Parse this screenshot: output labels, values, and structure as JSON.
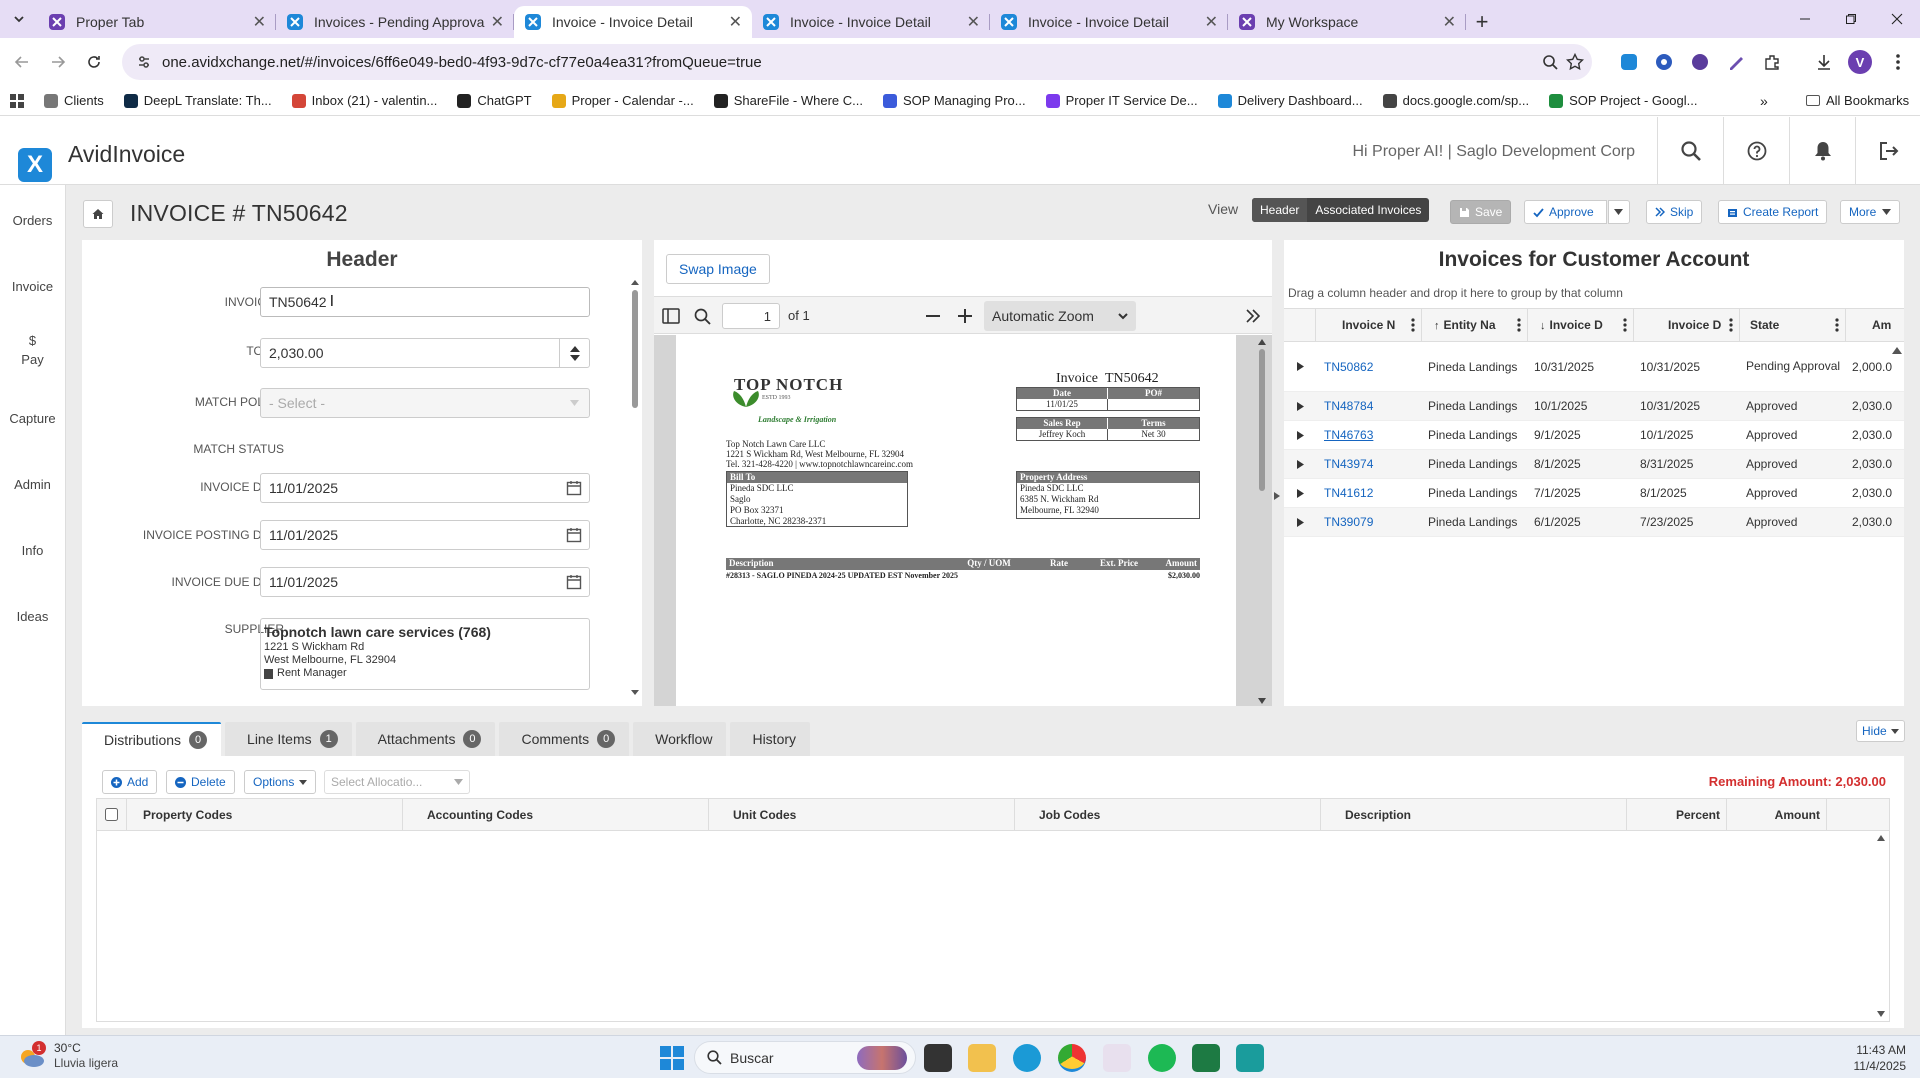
{
  "browser": {
    "tabs": [
      {
        "title": "Proper Tab",
        "active": false
      },
      {
        "title": "Invoices - Pending Approval",
        "active": false
      },
      {
        "title": "Invoice - Invoice Detail",
        "active": true
      },
      {
        "title": "Invoice - Invoice Detail",
        "active": false
      },
      {
        "title": "Invoice - Invoice Detail",
        "active": false
      },
      {
        "title": "My Workspace",
        "active": false
      }
    ],
    "url": "one.avidxchange.net/#/invoices/6ff6e049-bed0-4f93-9d7c-cf77e0a4ea31?fromQueue=true",
    "profile_initial": "V",
    "bookmarks": [
      "Clients",
      "DeepL Translate: Th...",
      "Inbox (21) - valentin...",
      "ChatGPT",
      "Proper - Calendar -...",
      "ShareFile - Where C...",
      "SOP Managing Pro...",
      "Proper IT Service De...",
      "Delivery Dashboard...",
      "docs.google.com/sp...",
      "SOP Project - Googl..."
    ],
    "all_bookmarks": "All Bookmarks"
  },
  "app": {
    "name": "AvidInvoice",
    "greeting": "Hi Proper AI! | Saglo Development Corp",
    "nav": [
      {
        "label": "Orders",
        "icon": "cart-icon"
      },
      {
        "label": "Invoice",
        "icon": "invoice-icon"
      },
      {
        "label": "Pay",
        "icon": "dollar-icon"
      },
      {
        "label": "Capture",
        "icon": "camera-icon"
      },
      {
        "label": "Admin",
        "icon": "gear-icon"
      },
      {
        "label": "Info",
        "icon": "chart-icon"
      },
      {
        "label": "Ideas",
        "icon": "bulb-icon"
      }
    ]
  },
  "toolbar": {
    "title": "INVOICE # TN50642",
    "view_label": "View",
    "view_options": [
      "Header",
      "Associated Invoices"
    ],
    "save": "Save",
    "approve": "Approve",
    "skip": "Skip",
    "create_report": "Create Report",
    "more": "More"
  },
  "form": {
    "title": "Header",
    "invoice_no_label": "INVOICE #",
    "invoice_no": "TN50642",
    "total_label": "TOTAL",
    "total": "2,030.00",
    "match_policy_label": "MATCH POLICY",
    "match_policy_placeholder": "- Select -",
    "match_status_label": "MATCH STATUS",
    "invoice_date_label": "INVOICE DATE",
    "invoice_date": "11/01/2025",
    "posting_date_label": "INVOICE POSTING DATE",
    "posting_date": "11/01/2025",
    "due_date_label": "INVOICE DUE DATE",
    "due_date": "11/01/2025",
    "supplier_label": "SUPPLIER",
    "supplier_name": "Topnotch lawn care services (768)",
    "supplier_addr1": "1221 S Wickham Rd",
    "supplier_addr2": "West Melbourne, FL 32904",
    "supplier_tag": "Rent Manager"
  },
  "pdf": {
    "swap_image": "Swap Image",
    "page": "1",
    "of": "of 1",
    "zoom": "Automatic Zoom",
    "doc": {
      "logo_line1": "TOP NOTCH",
      "logo_est": "ESTD  1993",
      "logo_line2": "Landscape & Irrigation",
      "invoice_label": "Invoice",
      "invoice_no": "TN50642",
      "date_h": "Date",
      "po_h": "PO#",
      "date_v": "11/01/25",
      "rep_h": "Sales Rep",
      "terms_h": "Terms",
      "rep_v": "Jeffrey Koch",
      "terms_v": "Net 30",
      "co_name": "Top Notch Lawn Care LLC",
      "co_addr": "1221 S Wickham Rd, West Melbourne, FL 32904",
      "co_contact": "Tel. 321-428-4220 | www.topnotchlawncareinc.com",
      "bill_to_h": "Bill To",
      "bill_to": [
        "Pineda SDC LLC",
        "Saglo",
        "PO Box 32371",
        "Charlotte, NC 28238-2371"
      ],
      "prop_h": "Property Address",
      "prop": [
        "Pineda SDC LLC",
        "6385 N. Wickham Rd",
        "Melbourne, FL 32940"
      ],
      "cols": [
        "Description",
        "Qty / UOM",
        "Rate",
        "Ext. Price",
        "Amount"
      ],
      "line_desc": "#28313 - SAGLO PINEDA 2024-25 UPDATED EST November 2025",
      "line_amt": "$2,030.00"
    }
  },
  "customer": {
    "title": "Invoices for Customer Account",
    "hint": "Drag a column header and drop it here to group by that column",
    "columns": [
      "Invoice N",
      "Entity Na",
      "Invoice D",
      "Invoice D",
      "State",
      "Am"
    ],
    "rows": [
      {
        "inv": "TN50862",
        "entity": "Pineda Landings",
        "d1": "10/31/2025",
        "d2": "10/31/2025",
        "state": "Pending Approval",
        "amt": "2,000.0"
      },
      {
        "inv": "TN48784",
        "entity": "Pineda Landings",
        "d1": "10/1/2025",
        "d2": "10/31/2025",
        "state": "Approved",
        "amt": "2,030.0"
      },
      {
        "inv": "TN46763",
        "entity": "Pineda Landings",
        "d1": "9/1/2025",
        "d2": "10/1/2025",
        "state": "Approved",
        "amt": "2,030.0"
      },
      {
        "inv": "TN43974",
        "entity": "Pineda Landings",
        "d1": "8/1/2025",
        "d2": "8/31/2025",
        "state": "Approved",
        "amt": "2,030.0"
      },
      {
        "inv": "TN41612",
        "entity": "Pineda Landings",
        "d1": "7/1/2025",
        "d2": "8/1/2025",
        "state": "Approved",
        "amt": "2,030.0"
      },
      {
        "inv": "TN39079",
        "entity": "Pineda Landings",
        "d1": "6/1/2025",
        "d2": "7/23/2025",
        "state": "Approved",
        "amt": "2,030.0"
      }
    ]
  },
  "bottom": {
    "tabs": [
      {
        "label": "Distributions",
        "count": "0",
        "icon": "list-icon"
      },
      {
        "label": "Line Items",
        "count": "1",
        "icon": "lines-icon"
      },
      {
        "label": "Attachments",
        "count": "0",
        "icon": "paperclip-icon"
      },
      {
        "label": "Comments",
        "count": "0",
        "icon": "comment-icon"
      },
      {
        "label": "Workflow",
        "count": "",
        "icon": "workflow-icon"
      },
      {
        "label": "History",
        "count": "",
        "icon": "history-icon"
      }
    ],
    "hide": "Hide",
    "add": "Add",
    "delete": "Delete",
    "options": "Options",
    "allocation_placeholder": "Select Allocatio...",
    "remaining": "Remaining Amount: 2,030.00",
    "columns": [
      "Property Codes",
      "Accounting Codes",
      "Unit Codes",
      "Job Codes",
      "Description",
      "Percent",
      "Amount"
    ]
  },
  "taskbar": {
    "weather_temp": "30°C",
    "weather_desc": "Lluvia ligera",
    "weather_badge": "1",
    "search": "Buscar",
    "time": "11:43 AM",
    "date": "11/4/2025"
  },
  "colors": {
    "accent": "#1e88d8",
    "link": "#1565c0",
    "danger": "#d32f2f"
  }
}
